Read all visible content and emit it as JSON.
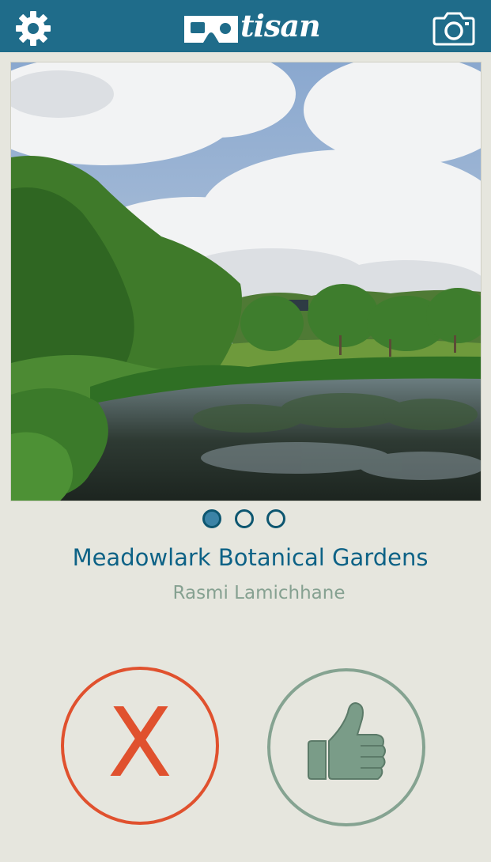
{
  "header": {
    "logo_text": "tisan",
    "settings_icon": "gear-icon",
    "camera_icon": "camera-icon",
    "bar_color": "#1f6c8a"
  },
  "photo": {
    "description_icon": "landscape-photo"
  },
  "pagination": {
    "count": 3,
    "active_index": 0
  },
  "place": {
    "title": "Meadowlark Botanical Gardens",
    "author": "Rasmi Lamichhane"
  },
  "actions": {
    "reject_label": "X",
    "reject_color": "#e0512e",
    "like_icon": "thumbs-up-icon",
    "like_color": "#85a391"
  }
}
